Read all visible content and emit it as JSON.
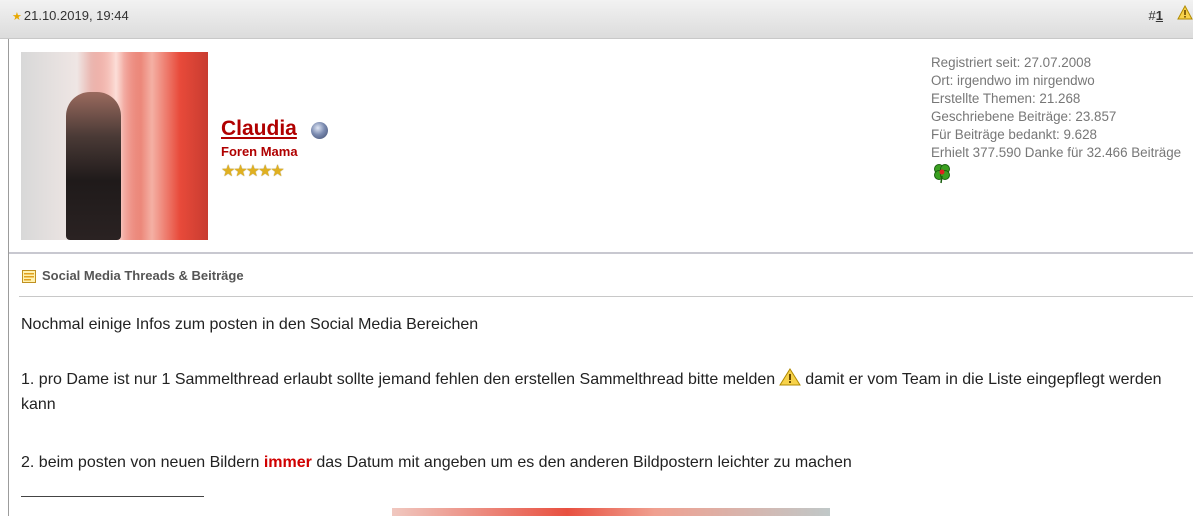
{
  "post_header": {
    "date": "21.10.2019, 19:44",
    "post_number_prefix": "#",
    "post_number": "1"
  },
  "user": {
    "name": "Claudia",
    "title": "Foren Mama",
    "rank_stars": "★★★★★",
    "stats": [
      "Registriert seit: 27.07.2008",
      "Ort: irgendwo im nirgendwo",
      "Erstellte Themen: 21.268",
      "Geschriebene Beiträge: 23.857",
      "Für Beiträge bedankt: 9.628",
      "Erhielt 377.590 Danke für 32.466 Beiträge"
    ]
  },
  "thread": {
    "title": "Social Media Threads & Beiträge"
  },
  "post": {
    "intro": "Nochmal einige Infos zum posten in den Social Media Bereichen",
    "point1_before": "1. pro Dame ist nur 1 Sammelthread erlaubt sollte jemand fehlen den erstellen Sammelthread bitte melden",
    "point1_after": "damit er vom Team in die Liste eingepflegt werden kann",
    "point2_before": "2. beim posten von neuen Bildern",
    "point2_highlight": "immer",
    "point2_after": "das Datum mit angeben um es den anderen Bildpostern leichter zu machen"
  },
  "colors": {
    "username": "#b00000",
    "highlight": "#d00000",
    "stats_text": "#777777"
  },
  "icons": [
    "star-icon",
    "warning-icon",
    "status-icon",
    "clover-icon",
    "thread-icon"
  ]
}
